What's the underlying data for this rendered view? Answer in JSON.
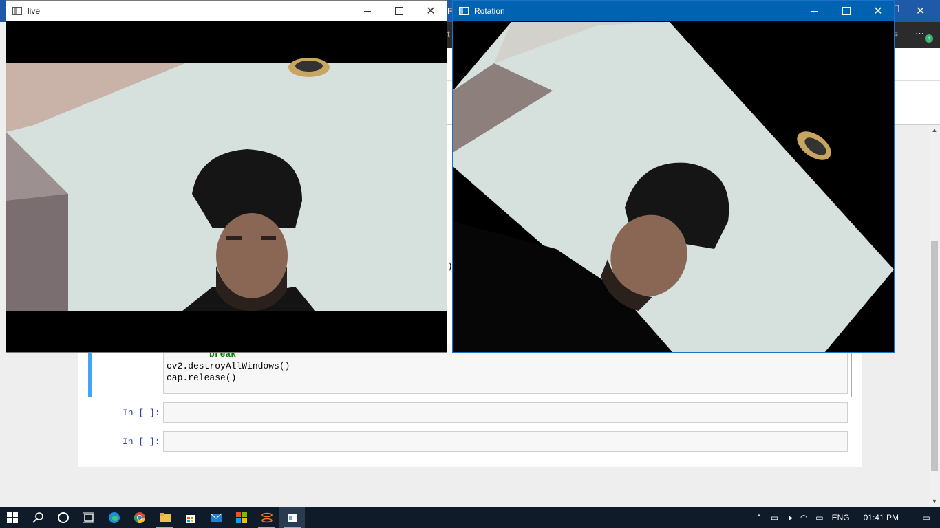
{
  "background": {
    "browser_tab_fragment": "Fa",
    "paren_fragment": ")",
    "code_lines": [
      "break",
      "cv2.destroyAllWindows()",
      "cap.release()"
    ],
    "cells": [
      {
        "prompt": "In [ ]:"
      },
      {
        "prompt": "In [ ]:"
      }
    ]
  },
  "windows": {
    "live": {
      "title": "live"
    },
    "rotation": {
      "title": "Rotation"
    }
  },
  "taskbar": {
    "apps": [
      "start-icon",
      "search-icon",
      "cortana-icon",
      "task-view-icon",
      "edge-icon",
      "chrome-icon",
      "file-explorer-icon",
      "store-icon",
      "mail-icon",
      "office-icon",
      "jupyter-icon",
      "python-window-icon"
    ],
    "language": "ENG",
    "time": "01:41 PM"
  },
  "colors": {
    "accent_blue": "#0063b1",
    "cell_border": "#42a5f5",
    "keyword": "#008000",
    "prompt": "#303f9f",
    "taskbar": "#101b2a"
  }
}
